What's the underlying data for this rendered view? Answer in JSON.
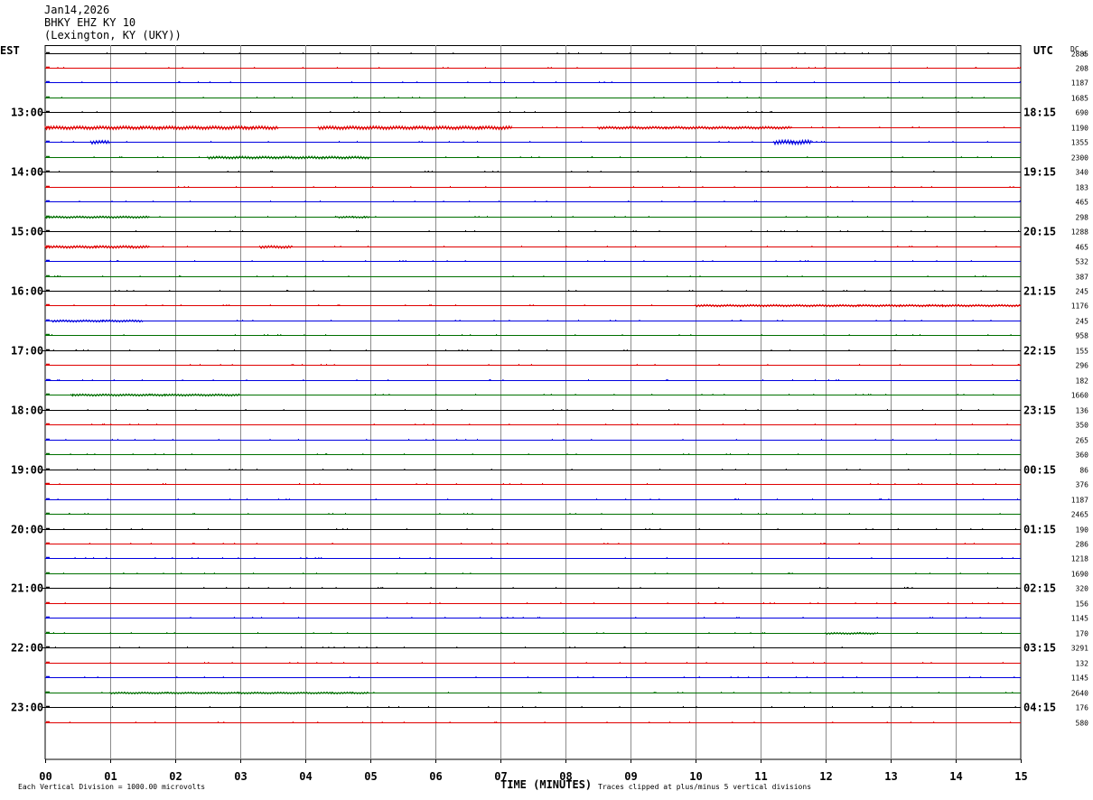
{
  "header": {
    "date": "Jan14,2026",
    "station": "BHKY EHZ KY 10",
    "location": "(Lexington, KY (UKY))"
  },
  "chart_data": {
    "type": "line",
    "title": "",
    "left_axis_label": "EST",
    "right_axis_label": "UTC",
    "dc_label": "DC",
    "xlabel": "TIME (MINUTES)",
    "xlim": [
      0,
      15
    ],
    "x_ticks": [
      "00",
      "01",
      "02",
      "03",
      "04",
      "05",
      "06",
      "07",
      "08",
      "09",
      "10",
      "11",
      "12",
      "13",
      "14",
      "15"
    ],
    "trace_colors": [
      "#000000",
      "#e00000",
      "#0000e0",
      "#007000"
    ],
    "est_labels": [
      {
        "trace": 4,
        "text": "13:00"
      },
      {
        "trace": 8,
        "text": "14:00"
      },
      {
        "trace": 12,
        "text": "15:00"
      },
      {
        "trace": 16,
        "text": "16:00"
      },
      {
        "trace": 20,
        "text": "17:00"
      },
      {
        "trace": 24,
        "text": "18:00"
      },
      {
        "trace": 28,
        "text": "19:00"
      },
      {
        "trace": 32,
        "text": "20:00"
      },
      {
        "trace": 36,
        "text": "21:00"
      },
      {
        "trace": 40,
        "text": "22:00"
      },
      {
        "trace": 44,
        "text": "23:00"
      }
    ],
    "utc_labels": [
      {
        "trace": 4,
        "text": "18:15"
      },
      {
        "trace": 8,
        "text": "19:15"
      },
      {
        "trace": 12,
        "text": "20:15"
      },
      {
        "trace": 16,
        "text": "21:15"
      },
      {
        "trace": 20,
        "text": "22:15"
      },
      {
        "trace": 24,
        "text": "23:15"
      },
      {
        "trace": 28,
        "text": "00:15"
      },
      {
        "trace": 32,
        "text": "01:15"
      },
      {
        "trace": 36,
        "text": "02:15"
      },
      {
        "trace": 40,
        "text": "03:15"
      },
      {
        "trace": 44,
        "text": "04:15"
      }
    ],
    "dc_offsets": [
      "2885",
      "208",
      "1187",
      "1685",
      "690",
      "1190",
      "1355",
      "2300",
      "340",
      "183",
      "465",
      "298",
      "1288",
      "465",
      "532",
      "387",
      "245",
      "1176",
      "245",
      "958",
      "155",
      "296",
      "182",
      "1660",
      "136",
      "350",
      "265",
      "360",
      "86",
      "376",
      "1187",
      "2465",
      "190",
      "286",
      "1218",
      "1690",
      "320",
      "156",
      "1145",
      "170",
      "3291",
      "132",
      "1145",
      "2640",
      "176",
      "580"
    ],
    "activity": [
      [],
      [],
      [],
      [],
      [],
      [
        [
          0.0,
          3.6,
          2
        ],
        [
          4.2,
          7.2,
          2
        ],
        [
          8.5,
          11.5,
          1.5
        ]
      ],
      [
        [
          0.7,
          1.0,
          2
        ],
        [
          11.2,
          11.8,
          2.5
        ]
      ],
      [
        [
          2.5,
          5.0,
          1.5
        ]
      ],
      [],
      [],
      [],
      [
        [
          0.0,
          1.6,
          1.2
        ],
        [
          4.5,
          5.0,
          1
        ]
      ],
      [],
      [
        [
          0.0,
          1.6,
          1.5
        ],
        [
          3.3,
          3.8,
          1.5
        ]
      ],
      [],
      [],
      [],
      [
        [
          10.0,
          15.0,
          1.2
        ]
      ],
      [
        [
          0.1,
          1.5,
          1.2
        ]
      ],
      [],
      [],
      [],
      [],
      [
        [
          0.4,
          3.0,
          1.2
        ]
      ],
      [],
      [],
      [],
      [],
      [],
      [],
      [],
      [],
      [],
      [],
      [],
      [],
      [],
      [],
      [],
      [
        [
          12.0,
          12.8,
          1
        ]
      ],
      [],
      [],
      [],
      [
        [
          1.0,
          5.0,
          1
        ]
      ],
      [],
      [],
      []
    ]
  },
  "footer": {
    "left": "Each Vertical Division = 1000.00 microvolts",
    "right": "Traces clipped at plus/minus 5 vertical divisions"
  }
}
